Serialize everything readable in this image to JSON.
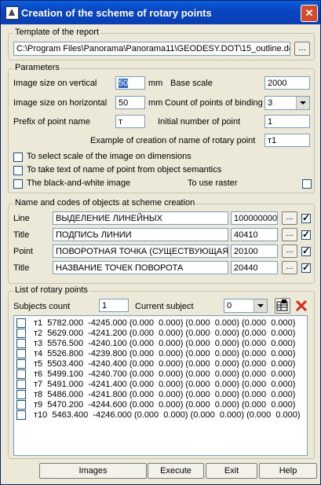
{
  "window": {
    "title": "Creation of the scheme of rotary points"
  },
  "template": {
    "group_label": "Template of the report",
    "path": "C:\\Program Files\\Panorama\\Panorama11\\GEODESY.DOT\\15_outline.do",
    "browse_label": "..."
  },
  "parameters": {
    "group_label": "Parameters",
    "img_vertical_label": "Image size on vertical",
    "img_vertical_value": "50",
    "unit_mm_1": "mm",
    "base_scale_label": "Base scale",
    "base_scale_value": "2000",
    "img_horizontal_label": "Image size on horizontal",
    "img_horizontal_value": "50",
    "unit_mm_2": "mm",
    "count_binding_label": "Count of points of binding",
    "count_binding_value": "3",
    "prefix_label": "Prefix of point name",
    "prefix_value": "т",
    "initial_number_label": "Initial number of point",
    "initial_number_value": "1",
    "example_label": "Example of creation of name of rotary point",
    "example_value": "т1",
    "chk_scale_label": "To select scale of the image on dimensions",
    "chk_semantics_label": "To take text of name of point from object semantics",
    "chk_bw_label": "The black-and-white image",
    "chk_raster_label": "To use raster"
  },
  "objects": {
    "group_label": "Name and codes of objects at scheme creation",
    "rows": [
      {
        "label": "Line",
        "name": "ВЫДЕЛЕНИЕ ЛИНЕЙНЫХ",
        "code": "100000000"
      },
      {
        "label": "Title",
        "name": "ПОДПИСЬ ЛИНИИ",
        "code": "40410"
      },
      {
        "label": "Point",
        "name": "ПОВОРОТНАЯ ТОЧКА (СУЩЕСТВУЮЩАЯ)",
        "code": "20100"
      },
      {
        "label": "Title",
        "name": "НАЗВАНИЕ ТОЧЕК ПОВОРОТА",
        "code": "20440"
      }
    ],
    "browse_label": "..."
  },
  "points": {
    "group_label": "List of rotary points",
    "subjects_count_label": "Subjects count",
    "subjects_count_value": "1",
    "current_subject_label": "Current subject",
    "current_subject_value": "0",
    "items": [
      "т1  5782.000  -4245.000 (0.000  0.000) (0.000  0.000) (0.000  0.000)",
      "т2  5629.000  -4241.200 (0.000  0.000) (0.000  0.000) (0.000  0.000)",
      "т3  5576.500  -4240.100 (0.000  0.000) (0.000  0.000) (0.000  0.000)",
      "т4  5526.800  -4239.800 (0.000  0.000) (0.000  0.000) (0.000  0.000)",
      "т5  5503.400  -4240.400 (0.000  0.000) (0.000  0.000) (0.000  0.000)",
      "т6  5499.100  -4240.700 (0.000  0.000) (0.000  0.000) (0.000  0.000)",
      "т7  5491.000  -4241.400 (0.000  0.000) (0.000  0.000) (0.000  0.000)",
      "т8  5486.000  -4241.800 (0.000  0.000) (0.000  0.000) (0.000  0.000)",
      "т9  5470.200  -4244.600 (0.000  0.000) (0.000  0.000) (0.000  0.000)",
      "т10  5463.400  -4246.000 (0.000  0.000) (0.000  0.000) (0.000  0.000)"
    ]
  },
  "buttons": {
    "images": "Images",
    "execute": "Execute",
    "exit": "Exit",
    "help": "Help"
  }
}
